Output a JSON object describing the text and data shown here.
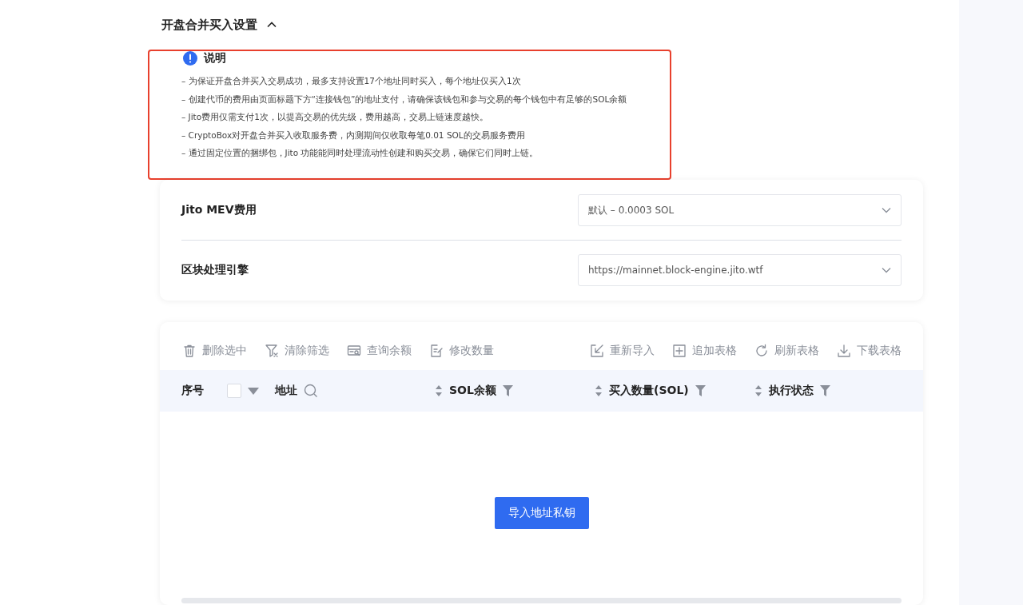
{
  "section": {
    "title": "开盘合并买入设置",
    "expanded": true
  },
  "notice": {
    "title": "说明",
    "items": [
      "– 为保证开盘合并买入交易成功，最多支持设置17个地址同时买入，每个地址仅买入1次",
      "– 创建代币的费用由页面标题下方“连接钱包”的地址支付，请确保该钱包和参与交易的每个钱包中有足够的SOL余额",
      "– Jito费用仅需支付1次，以提高交易的优先级，费用越高，交易上链速度越快。",
      "– CryptoBox对开盘合并买入收取服务费，内测期间仅收取每笔0.01 SOL的交易服务费用",
      "– 通过固定位置的捆绑包，Jito 功能能同时处理流动性创建和购买交易，确保它们同时上链。"
    ]
  },
  "settings": [
    {
      "label": "Jito MEV费用",
      "value": "默认 – 0.0003 SOL"
    },
    {
      "label": "区块处理引擎",
      "value": "https://mainnet.block-engine.jito.wtf"
    }
  ],
  "toolbar": {
    "left": [
      {
        "label": "删除选中",
        "kind": "trash"
      },
      {
        "label": "清除筛选",
        "kind": "filter"
      },
      {
        "label": "查询余额",
        "kind": "card"
      },
      {
        "label": "修改数量",
        "kind": "edit"
      }
    ],
    "right": [
      {
        "label": "重新导入",
        "kind": "import"
      },
      {
        "label": "追加表格",
        "kind": "add"
      },
      {
        "label": "刷新表格",
        "kind": "refresh"
      },
      {
        "label": "下载表格",
        "kind": "download"
      }
    ]
  },
  "table": {
    "select_all_checked": false,
    "columns": [
      {
        "label": "序号",
        "kind": "index"
      },
      {
        "label": "地址",
        "kind": "search"
      },
      {
        "label": "SOL余额",
        "kind": "sort-filter"
      },
      {
        "label": "买入数量(SOL)",
        "kind": "sort-filter"
      },
      {
        "label": "执行状态",
        "kind": "sort-filter"
      }
    ],
    "empty_action": "导入地址私钥"
  }
}
